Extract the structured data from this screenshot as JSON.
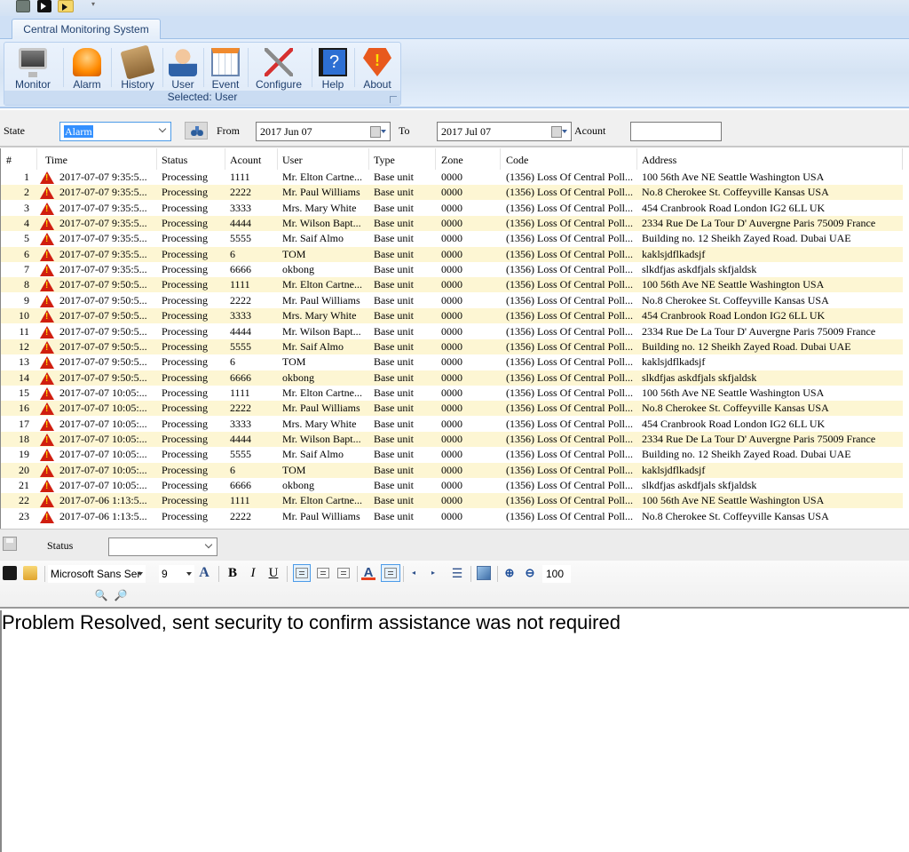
{
  "ribbon": {
    "tab_label": "Central Monitoring System",
    "buttons": [
      {
        "label": "Monitor",
        "icon": "monitor-icon"
      },
      {
        "label": "Alarm",
        "icon": "alarm-light-icon"
      },
      {
        "label": "History",
        "icon": "history-box-icon"
      },
      {
        "label": "User",
        "icon": "user-icon"
      },
      {
        "label": "Event",
        "icon": "calendar-event-icon"
      },
      {
        "label": "Configure",
        "icon": "tools-icon"
      },
      {
        "label": "Help",
        "icon": "help-book-icon"
      },
      {
        "label": "About",
        "icon": "about-warning-icon"
      }
    ],
    "group_caption": "Selected: User",
    "help_glyph": "?",
    "about_glyph": "!"
  },
  "quick_access": {
    "more_glyph": "▾"
  },
  "filter": {
    "state_label": "State",
    "state_value": "Alarm",
    "from_label": "From",
    "from_value": "2017 Jun 07",
    "to_label": "To",
    "to_value": "2017  Jul  07",
    "account_label": "Acount",
    "account_value": ""
  },
  "grid": {
    "columns": [
      "#",
      "Time",
      "Status",
      "Acount",
      "User",
      "Type",
      "Zone",
      "Code",
      "Address"
    ],
    "rows": [
      {
        "n": "1",
        "time": "2017-07-07 9:35:5...",
        "status": "Processing",
        "account": "1111",
        "user": "Mr. Elton Cartne...",
        "type": "Base unit",
        "zone": "0000",
        "code": "(1356) Loss Of Central Poll...",
        "address": "100 56th Ave NE Seattle Washington USA"
      },
      {
        "n": "2",
        "time": "2017-07-07 9:35:5...",
        "status": "Processing",
        "account": "2222",
        "user": "Mr. Paul Williams",
        "type": "Base unit",
        "zone": "0000",
        "code": "(1356) Loss Of Central Poll...",
        "address": "No.8 Cherokee St. Coffeyville Kansas USA"
      },
      {
        "n": "3",
        "time": "2017-07-07 9:35:5...",
        "status": "Processing",
        "account": "3333",
        "user": "Mrs. Mary White",
        "type": "Base unit",
        "zone": "0000",
        "code": "(1356) Loss Of Central Poll...",
        "address": "454 Cranbrook Road London IG2 6LL UK"
      },
      {
        "n": "4",
        "time": "2017-07-07 9:35:5...",
        "status": "Processing",
        "account": "4444",
        "user": "Mr. Wilson Bapt...",
        "type": "Base unit",
        "zone": "0000",
        "code": "(1356) Loss Of Central Poll...",
        "address": "2334 Rue De La Tour D' Auvergne Paris 75009 France"
      },
      {
        "n": "5",
        "time": "2017-07-07 9:35:5...",
        "status": "Processing",
        "account": "5555",
        "user": "Mr. Saif Almo",
        "type": "Base unit",
        "zone": "0000",
        "code": "(1356) Loss Of Central Poll...",
        "address": "Building no. 12 Sheikh Zayed Road. Dubai UAE"
      },
      {
        "n": "6",
        "time": "2017-07-07 9:35:5...",
        "status": "Processing",
        "account": "6",
        "user": "TOM",
        "type": "Base unit",
        "zone": "0000",
        "code": "(1356) Loss Of Central Poll...",
        "address": "kaklsjdflkadsjf"
      },
      {
        "n": "7",
        "time": "2017-07-07 9:35:5...",
        "status": "Processing",
        "account": "6666",
        "user": "okbong",
        "type": "Base unit",
        "zone": "0000",
        "code": "(1356) Loss Of Central Poll...",
        "address": "slkdfjas askdfjals skfjaldsk"
      },
      {
        "n": "8",
        "time": "2017-07-07 9:50:5...",
        "status": "Processing",
        "account": "1111",
        "user": "Mr. Elton Cartne...",
        "type": "Base unit",
        "zone": "0000",
        "code": "(1356) Loss Of Central Poll...",
        "address": "100 56th Ave NE Seattle Washington USA"
      },
      {
        "n": "9",
        "time": "2017-07-07 9:50:5...",
        "status": "Processing",
        "account": "2222",
        "user": "Mr. Paul Williams",
        "type": "Base unit",
        "zone": "0000",
        "code": "(1356) Loss Of Central Poll...",
        "address": "No.8 Cherokee St. Coffeyville Kansas USA"
      },
      {
        "n": "10",
        "time": "2017-07-07 9:50:5...",
        "status": "Processing",
        "account": "3333",
        "user": "Mrs. Mary White",
        "type": "Base unit",
        "zone": "0000",
        "code": "(1356) Loss Of Central Poll...",
        "address": "454 Cranbrook Road London IG2 6LL UK"
      },
      {
        "n": "11",
        "time": "2017-07-07 9:50:5...",
        "status": "Processing",
        "account": "4444",
        "user": "Mr. Wilson Bapt...",
        "type": "Base unit",
        "zone": "0000",
        "code": "(1356) Loss Of Central Poll...",
        "address": "2334 Rue De La Tour D' Auvergne Paris 75009 France"
      },
      {
        "n": "12",
        "time": "2017-07-07 9:50:5...",
        "status": "Processing",
        "account": "5555",
        "user": "Mr. Saif Almo",
        "type": "Base unit",
        "zone": "0000",
        "code": "(1356) Loss Of Central Poll...",
        "address": "Building no. 12 Sheikh Zayed Road. Dubai UAE"
      },
      {
        "n": "13",
        "time": "2017-07-07 9:50:5...",
        "status": "Processing",
        "account": "6",
        "user": "TOM",
        "type": "Base unit",
        "zone": "0000",
        "code": "(1356) Loss Of Central Poll...",
        "address": "kaklsjdflkadsjf"
      },
      {
        "n": "14",
        "time": "2017-07-07 9:50:5...",
        "status": "Processing",
        "account": "6666",
        "user": "okbong",
        "type": "Base unit",
        "zone": "0000",
        "code": "(1356) Loss Of Central Poll...",
        "address": "slkdfjas askdfjals skfjaldsk"
      },
      {
        "n": "15",
        "time": "2017-07-07 10:05:...",
        "status": "Processing",
        "account": "1111",
        "user": "Mr. Elton Cartne...",
        "type": "Base unit",
        "zone": "0000",
        "code": "(1356) Loss Of Central Poll...",
        "address": "100 56th Ave NE Seattle Washington USA"
      },
      {
        "n": "16",
        "time": "2017-07-07 10:05:...",
        "status": "Processing",
        "account": "2222",
        "user": "Mr. Paul Williams",
        "type": "Base unit",
        "zone": "0000",
        "code": "(1356) Loss Of Central Poll...",
        "address": "No.8 Cherokee St. Coffeyville Kansas USA"
      },
      {
        "n": "17",
        "time": "2017-07-07 10:05:...",
        "status": "Processing",
        "account": "3333",
        "user": "Mrs. Mary White",
        "type": "Base unit",
        "zone": "0000",
        "code": "(1356) Loss Of Central Poll...",
        "address": "454 Cranbrook Road London IG2 6LL UK"
      },
      {
        "n": "18",
        "time": "2017-07-07 10:05:...",
        "status": "Processing",
        "account": "4444",
        "user": "Mr. Wilson Bapt...",
        "type": "Base unit",
        "zone": "0000",
        "code": "(1356) Loss Of Central Poll...",
        "address": "2334 Rue De La Tour D' Auvergne Paris 75009 France"
      },
      {
        "n": "19",
        "time": "2017-07-07 10:05:...",
        "status": "Processing",
        "account": "5555",
        "user": "Mr. Saif Almo",
        "type": "Base unit",
        "zone": "0000",
        "code": "(1356) Loss Of Central Poll...",
        "address": "Building no. 12 Sheikh Zayed Road. Dubai UAE"
      },
      {
        "n": "20",
        "time": "2017-07-07 10:05:...",
        "status": "Processing",
        "account": "6",
        "user": "TOM",
        "type": "Base unit",
        "zone": "0000",
        "code": "(1356) Loss Of Central Poll...",
        "address": "kaklsjdflkadsjf"
      },
      {
        "n": "21",
        "time": "2017-07-07 10:05:...",
        "status": "Processing",
        "account": "6666",
        "user": "okbong",
        "type": "Base unit",
        "zone": "0000",
        "code": "(1356) Loss Of Central Poll...",
        "address": "slkdfjas askdfjals skfjaldsk"
      },
      {
        "n": "22",
        "time": "2017-07-06 1:13:5...",
        "status": "Processing",
        "account": "1111",
        "user": "Mr. Elton Cartne...",
        "type": "Base unit",
        "zone": "0000",
        "code": "(1356) Loss Of Central Poll...",
        "address": "100 56th Ave NE Seattle Washington USA"
      },
      {
        "n": "23",
        "time": "2017-07-06 1:13:5...",
        "status": "Processing",
        "account": "2222",
        "user": "Mr. Paul Williams",
        "type": "Base unit",
        "zone": "0000",
        "code": "(1356) Loss Of Central Poll...",
        "address": "No.8 Cherokee St. Coffeyville Kansas USA"
      }
    ]
  },
  "status_bar": {
    "status_label": "Status",
    "status_value": ""
  },
  "editor_toolbar": {
    "font_name": "Microsoft Sans Ser",
    "font_size": "9",
    "bold": "B",
    "italic": "I",
    "underline": "U",
    "zoom_value": "100"
  },
  "editor": {
    "text": "Problem Resolved, sent security to confirm assistance was not required"
  },
  "colors": {
    "alt_row": "#fdf6d3",
    "selection": "#3390ff",
    "alarm_icon": "#d01e10"
  }
}
